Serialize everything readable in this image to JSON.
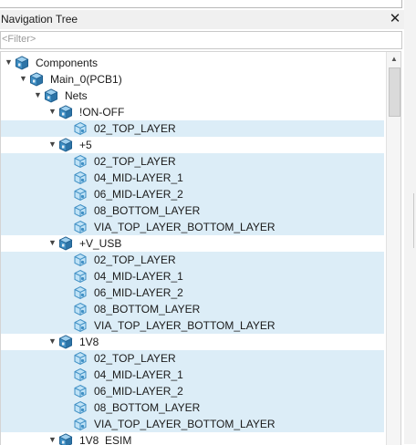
{
  "panel": {
    "title": "Navigation Tree",
    "close_symbol": "✕",
    "filter_placeholder": "<Filter>",
    "filter_value": ""
  },
  "scrollbar": {
    "up_arrow": "▲",
    "position": 0.0
  },
  "tree": [
    {
      "id": "components",
      "label": "Components",
      "depth": 0,
      "expanded": true,
      "icon": "component-cube-icon",
      "selected": false
    },
    {
      "id": "main0",
      "label": "Main_0(PCB1)",
      "depth": 1,
      "expanded": true,
      "icon": "pcb-cube-icon",
      "selected": false
    },
    {
      "id": "nets",
      "label": "Nets",
      "depth": 2,
      "expanded": true,
      "icon": "nets-cube-icon",
      "selected": false
    },
    {
      "id": "net-on-off",
      "label": "!ON-OFF",
      "depth": 3,
      "expanded": true,
      "icon": "net-cube-icon",
      "selected": false
    },
    {
      "id": "on-off-02",
      "label": "02_TOP_LAYER",
      "depth": 4,
      "icon": "layer-cube-icon",
      "selected": true
    },
    {
      "id": "net-plus5",
      "label": "+5",
      "depth": 3,
      "expanded": true,
      "icon": "net-cube-icon",
      "selected": false
    },
    {
      "id": "p5-02",
      "label": "02_TOP_LAYER",
      "depth": 4,
      "icon": "layer-cube-icon",
      "selected": true
    },
    {
      "id": "p5-04",
      "label": "04_MID-LAYER_1",
      "depth": 4,
      "icon": "layer-cube-icon",
      "selected": true
    },
    {
      "id": "p5-06",
      "label": "06_MID-LAYER_2",
      "depth": 4,
      "icon": "layer-cube-icon",
      "selected": true
    },
    {
      "id": "p5-08",
      "label": "08_BOTTOM_LAYER",
      "depth": 4,
      "icon": "layer-cube-icon",
      "selected": true
    },
    {
      "id": "p5-via",
      "label": "VIA_TOP_LAYER_BOTTOM_LAYER",
      "depth": 4,
      "icon": "layer-cube-icon",
      "selected": true
    },
    {
      "id": "net-vusb",
      "label": "+V_USB",
      "depth": 3,
      "expanded": true,
      "icon": "net-cube-icon",
      "selected": false
    },
    {
      "id": "vusb-02",
      "label": "02_TOP_LAYER",
      "depth": 4,
      "icon": "layer-cube-icon",
      "selected": true
    },
    {
      "id": "vusb-04",
      "label": "04_MID-LAYER_1",
      "depth": 4,
      "icon": "layer-cube-icon",
      "selected": true
    },
    {
      "id": "vusb-06",
      "label": "06_MID-LAYER_2",
      "depth": 4,
      "icon": "layer-cube-icon",
      "selected": true
    },
    {
      "id": "vusb-08",
      "label": "08_BOTTOM_LAYER",
      "depth": 4,
      "icon": "layer-cube-icon",
      "selected": true
    },
    {
      "id": "vusb-via",
      "label": "VIA_TOP_LAYER_BOTTOM_LAYER",
      "depth": 4,
      "icon": "layer-cube-icon",
      "selected": true
    },
    {
      "id": "net-1v8",
      "label": "1V8",
      "depth": 3,
      "expanded": true,
      "icon": "net-cube-icon",
      "selected": false
    },
    {
      "id": "1v8-02",
      "label": "02_TOP_LAYER",
      "depth": 4,
      "icon": "layer-cube-icon",
      "selected": true
    },
    {
      "id": "1v8-04",
      "label": "04_MID-LAYER_1",
      "depth": 4,
      "icon": "layer-cube-icon",
      "selected": true
    },
    {
      "id": "1v8-06",
      "label": "06_MID-LAYER_2",
      "depth": 4,
      "icon": "layer-cube-icon",
      "selected": true
    },
    {
      "id": "1v8-08",
      "label": "08_BOTTOM_LAYER",
      "depth": 4,
      "icon": "layer-cube-icon",
      "selected": true
    },
    {
      "id": "1v8-via",
      "label": "VIA_TOP_LAYER_BOTTOM_LAYER",
      "depth": 4,
      "icon": "layer-cube-icon",
      "selected": true
    },
    {
      "id": "net-1v8esim",
      "label": "1V8_ESIM",
      "depth": 3,
      "expanded": true,
      "icon": "net-cube-icon",
      "selected": false
    }
  ],
  "colors": {
    "selection": "#dcedf7",
    "net_cube_face": "#3f8fc4",
    "net_cube_light": "#9fd0ef",
    "net_cube_dark": "#1f5f8f",
    "layer_cube_face": "#bfe2f6",
    "layer_cube_stroke": "#3f8fc4"
  }
}
